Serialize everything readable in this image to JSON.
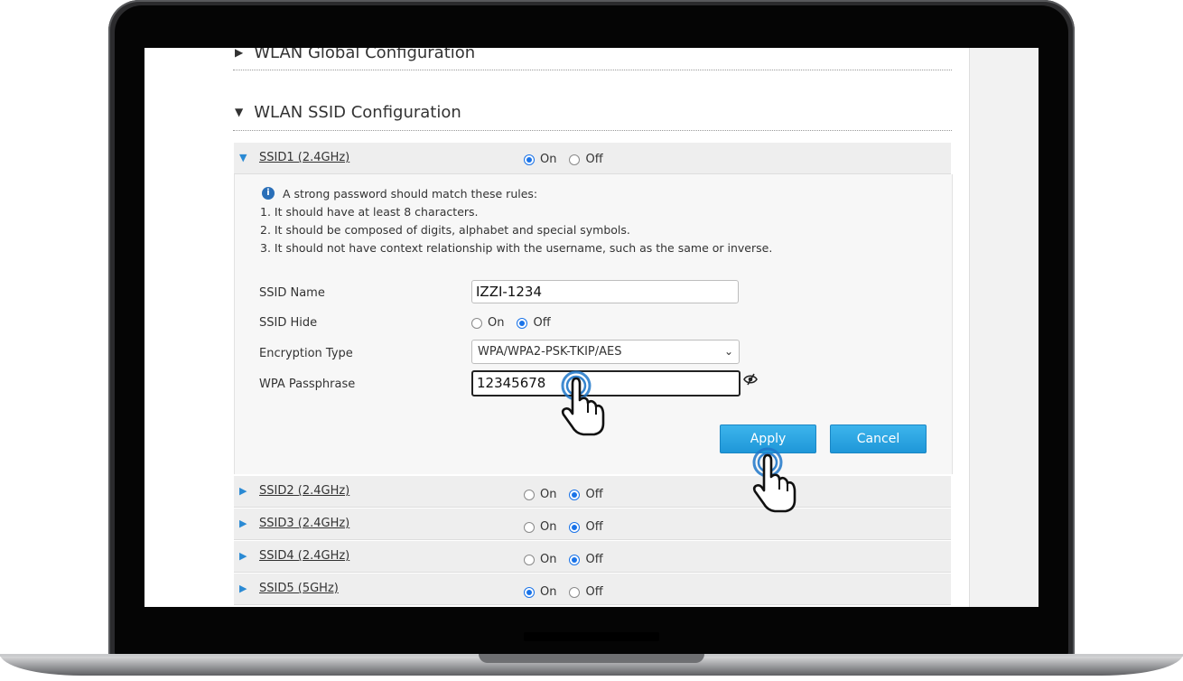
{
  "sections": {
    "global_title": "WLAN Global Configuration",
    "ssid_title": "WLAN SSID Configuration"
  },
  "radio_labels": {
    "on": "On",
    "off": "Off"
  },
  "ssid1": {
    "name": "SSID1 (2.4GHz)",
    "state": "On",
    "rules": {
      "intro": "A strong password should match these rules:",
      "rule1": "1. It should have at least 8 characters.",
      "rule2": "2. It should be composed of digits, alphabet and special symbols.",
      "rule3": "3. It should not have context relationship with the username, such as the same or inverse."
    },
    "fields": {
      "ssid_name_label": "SSID Name",
      "ssid_name_value": "IZZI-1234",
      "ssid_hide_label": "SSID Hide",
      "ssid_hide_value": "Off",
      "encryption_label": "Encryption Type",
      "encryption_value": "WPA/WPA2-PSK-TKIP/AES",
      "passphrase_label": "WPA Passphrase",
      "passphrase_value": "12345678"
    },
    "apply_label": "Apply",
    "cancel_label": "Cancel"
  },
  "other_ssids": [
    {
      "name": "SSID2 (2.4GHz)",
      "state": "Off"
    },
    {
      "name": "SSID3 (2.4GHz)",
      "state": "Off"
    },
    {
      "name": "SSID4 (2.4GHz)",
      "state": "Off"
    },
    {
      "name": "SSID5 (5GHz)",
      "state": "On"
    }
  ],
  "colors": {
    "accent_blue": "#2a8ad4",
    "button_blue": "#1f97d8",
    "row_gray": "#eeeeee",
    "bezel": "#050505"
  },
  "icons": [
    "info-icon",
    "eye-toggle-icon",
    "hand-pointer-icon",
    "expand-arrow-icon",
    "collapse-arrow-icon",
    "chevron-down-icon"
  ]
}
